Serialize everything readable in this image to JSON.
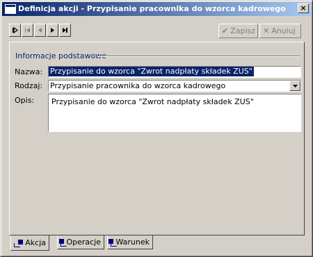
{
  "window": {
    "title": "Definicja akcji - Przypisanie pracownika do wzorca kadrowego",
    "close_label": "×"
  },
  "toolbar": {
    "nav_icons": [
      "first-record-icon",
      "prev-record-icon",
      "play-record-icon",
      "last-record-icon"
    ],
    "save_label": "Zapisz",
    "cancel_label": "Anuluj",
    "save_icon": "✔",
    "cancel_icon": "✕"
  },
  "section": {
    "title": "Informacje podstawowe"
  },
  "form": {
    "name_label": "Nazwa:",
    "name_value": "Przypisanie do wzorca \"Zwrot nadpłaty składek ZUS\"",
    "type_label": "Rodzaj:",
    "type_value": "Przypisanie pracownika do wzorca kadrowego",
    "desc_label": "Opis:",
    "desc_value": "Przypisanie do wzorca \"Zwrot nadpłaty składek ZUS\""
  },
  "tabs": [
    {
      "label": "Akcja",
      "active": true
    },
    {
      "label": "Operacje",
      "active": false
    },
    {
      "label": "Warunek",
      "active": false
    }
  ],
  "colors": {
    "title_start": "#0a246a",
    "title_end": "#a6caf0",
    "face": "#d4d0c8",
    "selection": "#0a246a"
  }
}
